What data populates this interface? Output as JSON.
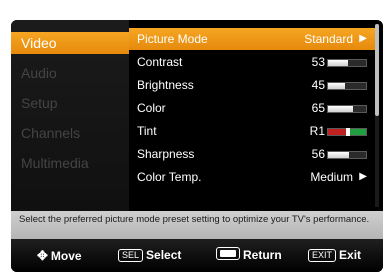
{
  "categories": [
    {
      "label": "Video",
      "active": true
    },
    {
      "label": "Audio",
      "active": false
    },
    {
      "label": "Setup",
      "active": false
    },
    {
      "label": "Channels",
      "active": false
    },
    {
      "label": "Multimedia",
      "active": false
    }
  ],
  "settings": {
    "picture_mode": {
      "label": "Picture Mode",
      "value": "Standard"
    },
    "contrast": {
      "label": "Contrast",
      "value": "53",
      "level": 0.53
    },
    "brightness": {
      "label": "Brightness",
      "value": "45",
      "level": 0.45
    },
    "color": {
      "label": "Color",
      "value": "65",
      "level": 0.65
    },
    "tint": {
      "label": "Tint",
      "value": "R1",
      "level": 0.52
    },
    "sharpness": {
      "label": "Sharpness",
      "value": "56",
      "level": 0.56
    },
    "color_temp": {
      "label": "Color Temp.",
      "value": "Medium"
    }
  },
  "help_text": "Select the preferred picture mode preset setting to optimize your TV's performance.",
  "footer": {
    "move": "Move",
    "select_key": "SEL",
    "select": "Select",
    "return": "Return",
    "exit_key": "EXIT",
    "exit": "Exit"
  },
  "icons": {
    "submenu_arrow": "arrow-right-icon",
    "move": "dpad-icon",
    "return": "return-key-icon"
  },
  "colors": {
    "highlight": "#f6a623",
    "tint_red": "#c02020",
    "tint_green": "#20a040"
  }
}
